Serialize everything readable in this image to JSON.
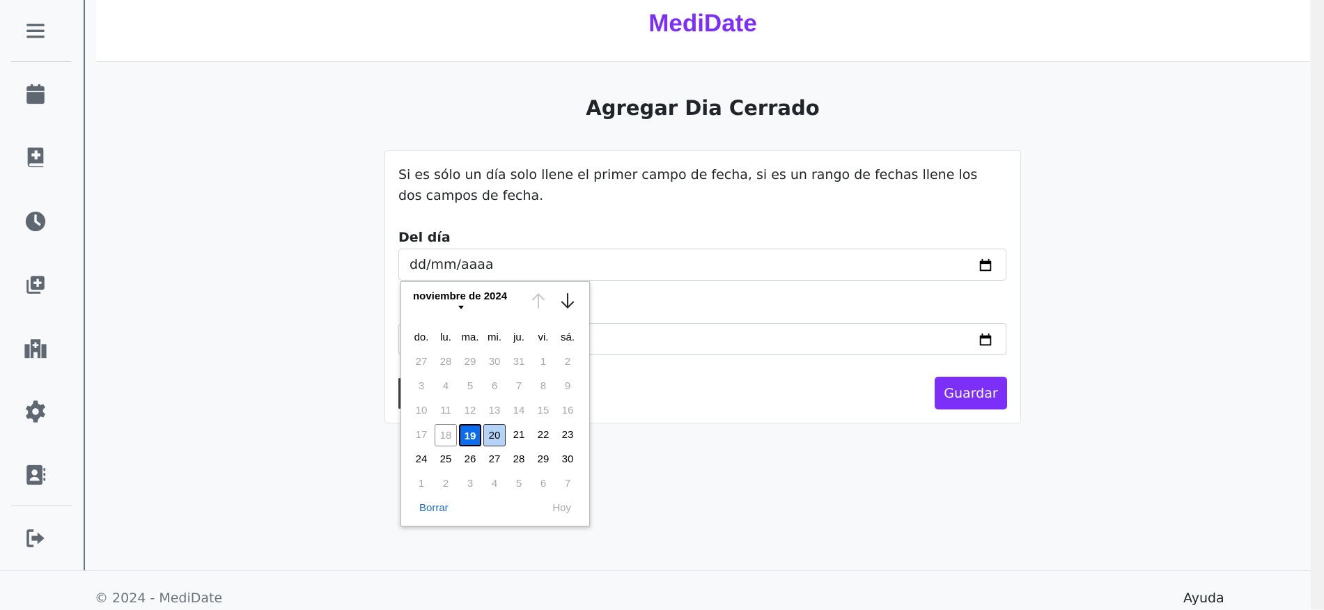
{
  "app": {
    "brand": "MediDate"
  },
  "sidebar": {
    "items": [
      {
        "name": "menu-icon"
      },
      {
        "name": "calendar-icon"
      },
      {
        "name": "medical-book-icon"
      },
      {
        "name": "clock-icon"
      },
      {
        "name": "add-copy-icon"
      },
      {
        "name": "hospital-icon"
      },
      {
        "name": "gear-icon"
      },
      {
        "name": "contact-card-icon"
      },
      {
        "name": "logout-icon"
      }
    ]
  },
  "main": {
    "title": "Agregar Dia Cerrado",
    "instructions": "Si es sólo un día solo llene el primer campo de fecha, si es un rango de fechas llene los dos campos de fecha.",
    "from_label": "Del día",
    "from_value": "dd/mm/aaaa",
    "save_label": "Guardar"
  },
  "picker": {
    "month_label": "noviembre de 2024",
    "weekdays": [
      "do.",
      "lu.",
      "ma.",
      "mi.",
      "ju.",
      "vi.",
      "sá."
    ],
    "weeks": [
      [
        "27",
        "28",
        "29",
        "30",
        "31",
        "1",
        "2"
      ],
      [
        "3",
        "4",
        "5",
        "6",
        "7",
        "8",
        "9"
      ],
      [
        "10",
        "11",
        "12",
        "13",
        "14",
        "15",
        "16"
      ],
      [
        "17",
        "18",
        "19",
        "20",
        "21",
        "22",
        "23"
      ],
      [
        "24",
        "25",
        "26",
        "27",
        "28",
        "29",
        "30"
      ],
      [
        "1",
        "2",
        "3",
        "4",
        "5",
        "6",
        "7"
      ]
    ],
    "clear_label": "Borrar",
    "today_label": "Hoy"
  },
  "footer": {
    "copyright": "© 2024 - MediDate",
    "help": "Ayuda"
  },
  "colors": {
    "brand": "#7b2ff7",
    "selected_day": "#0a6df0",
    "range_day": "#b5d3f7"
  }
}
